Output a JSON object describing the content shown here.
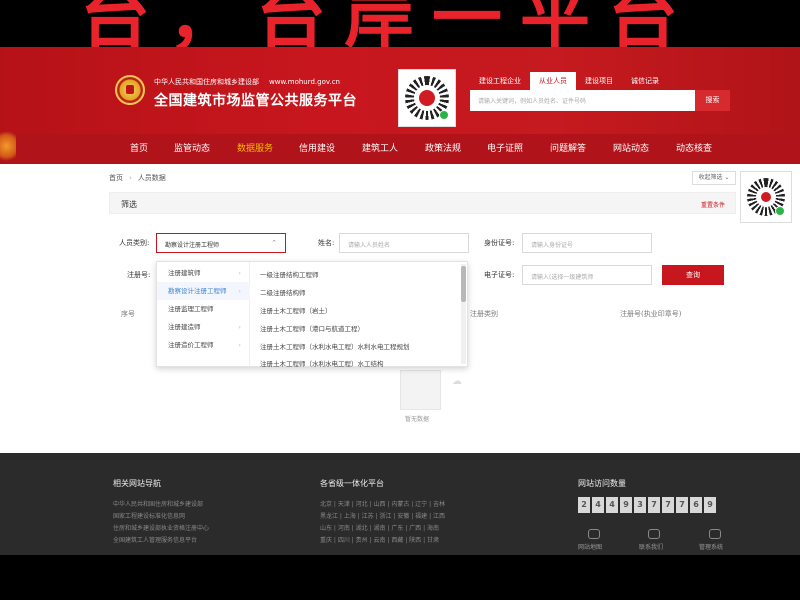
{
  "overlay": {
    "banner_text": "台，台岸一平台"
  },
  "header": {
    "ministry": "中华人民共和国住房和城乡建设部",
    "url": "www.mohurd.gov.cn",
    "platform_title": "全国建筑市场监管公共服务平台",
    "search_tabs": [
      "建设工程企业",
      "从业人员",
      "建设项目",
      "诚信记录"
    ],
    "active_search_tab": "从业人员",
    "search_placeholder": "请输入关键词，例如人员姓名、证件号码",
    "search_button": "搜索"
  },
  "nav": {
    "items": [
      "首页",
      "监管动态",
      "数据服务",
      "信用建设",
      "建筑工人",
      "政策法规",
      "电子证照",
      "问题解答",
      "网站动态",
      "动态核查"
    ],
    "active": "数据服务"
  },
  "breadcrumb": {
    "home": "首页",
    "current": "人员数据"
  },
  "collapse_label": "收起筛选 ⌄",
  "filter": {
    "title": "筛选",
    "reset": "重置条件",
    "category_label": "人员类别:",
    "category_value": "勘察设计注册工程师",
    "name_label": "姓名:",
    "name_placeholder": "请输入人员姓名",
    "id_label": "身份证号:",
    "id_placeholder": "请输入身份证号",
    "reg_label": "注册号:",
    "cert_label": "电子证号:",
    "cert_placeholder": "请输入(选择一级建筑师",
    "query_button": "查询"
  },
  "dropdown": {
    "level1": [
      "注册建筑师",
      "勘察设计注册工程师",
      "注册监理工程师",
      "注册建造师",
      "注册造价工程师"
    ],
    "active": "勘察设计注册工程师",
    "level2": [
      "一级注册结构工程师",
      "二级注册结构师",
      "注册土木工程师（岩土）",
      "注册土木工程师（港口与航道工程）",
      "注册土木工程师（水利水电工程）水利水电工程规划",
      "注册土木工程师（水利水电工程）水工结构"
    ]
  },
  "table_headers": {
    "index": "序号",
    "category": "注册类别",
    "cert": "注册号(执业印章号)"
  },
  "empty_text": "暂无数据",
  "footer": {
    "nav_title": "相关网站导航",
    "nav_links": [
      "中华人民共和国住房和城乡建设部",
      "国家工程建设标准化信息网",
      "住房和城乡建设部执业资格注册中心",
      "全国建筑工人管理服务信息平台"
    ],
    "province_title": "各省级一体化平台",
    "province_lines": [
      "北京 | 天津 | 河北 | 山西 | 内蒙古 | 辽宁 | 吉林",
      "黑龙江 | 上海 | 江苏 | 浙江 | 安徽 | 福建 | 江西",
      "山东 | 河南 | 湖北 | 湖南 | 广东 | 广西 | 海南",
      "重庆 | 四川 | 贵州 | 云南 | 西藏 | 陕西 | 甘肃"
    ],
    "visits_title": "网站访问数量",
    "visits_digits": [
      "2",
      "4",
      "4",
      "9",
      "3",
      "7",
      "7",
      "7",
      "6",
      "9"
    ],
    "icons": [
      {
        "label": "网站地图",
        "icon": "sitemap-icon"
      },
      {
        "label": "联系我们",
        "icon": "chat-icon"
      },
      {
        "label": "管理系统",
        "icon": "admin-icon"
      }
    ]
  },
  "colors": {
    "brand_red": "#c8161e",
    "accent_gold": "#f5b800",
    "link_blue": "#3e7fd1",
    "footer_bg": "#2b2b2b"
  }
}
